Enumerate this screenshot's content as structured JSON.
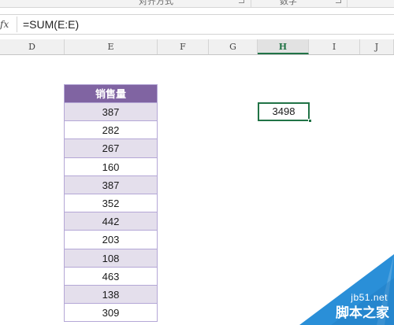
{
  "ribbon": {
    "groups": [
      {
        "label": "对齐方式"
      },
      {
        "label": "数字"
      }
    ]
  },
  "formula_bar": {
    "fx_label": "fx",
    "formula": "=SUM(E:E)"
  },
  "columns": [
    "D",
    "E",
    "F",
    "G",
    "H",
    "I",
    "J"
  ],
  "active_column": "H",
  "sales_table": {
    "header": "销售量",
    "values": [
      "387",
      "282",
      "267",
      "160",
      "387",
      "352",
      "442",
      "203",
      "108",
      "463",
      "138",
      "309"
    ]
  },
  "active_cell": {
    "value": "3498"
  },
  "watermark": {
    "site": "jb51.net",
    "brand": "脚本之家"
  },
  "colors": {
    "accent_green": "#217346",
    "table_header": "#8064a2",
    "table_band": "#e4dfec",
    "watermark_bg": "#2a8fd8"
  }
}
